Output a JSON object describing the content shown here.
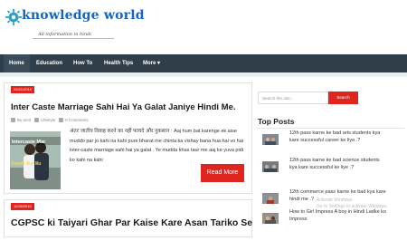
{
  "header": {
    "logo_text": "knowledge world",
    "tagline": "All information in hindi"
  },
  "nav": {
    "items": [
      {
        "label": "Home"
      },
      {
        "label": "Education"
      },
      {
        "label": "How To"
      },
      {
        "label": "Health Tips"
      },
      {
        "label": "More ▾"
      }
    ]
  },
  "posts": [
    {
      "date": "02/21/2019",
      "title": "Inter Caste Marriage  Sahi Hai Ya Galat Janiye Hindi Me.",
      "author": "By amit",
      "category": "Lifestyle",
      "comments": "0 Comments",
      "thumb_text_top": "Intercaste Mar",
      "thumb_text_bottom": "Fayda Aur Nu",
      "excerpt_hindi": "अंतर जातीय विवाह करने का नहीं फायदे  और नुकसान :",
      "excerpt_rest": "Aaj hum bat karenge ek aise muddo par jo kahi na kahi pure bharat me chinta ka vishay bana hua hai vo hai inter-caste marriage sahi hai ya galat . Ye mudda khas taur me aaj ke yuva pidi  ko kahi na kahi",
      "read_more": "Read More"
    },
    {
      "date": "11/26/2018",
      "title": "CGPSC ki Taiyari Ghar Par Kaise Kare Asan Tariko Se"
    }
  ],
  "sidebar": {
    "search_placeholder": "Search this site...",
    "search_button": "Search",
    "top_posts_title": "Top Posts",
    "top_posts": [
      {
        "title": "12th pass karne ke bad arts students kya kare successful career ke liye..?"
      },
      {
        "title": "12th pass karne ke bad science students kya kare successful ke liye .?"
      },
      {
        "title": "12th commerce pass karne ke bad kya kare hindi me .?"
      },
      {
        "title": "How to Girl Impress A boy in Hindi Ladke ko Impress"
      }
    ]
  },
  "watermark": {
    "line1": "Activate Windows",
    "line2": "Go to Settings to activate Windows."
  }
}
